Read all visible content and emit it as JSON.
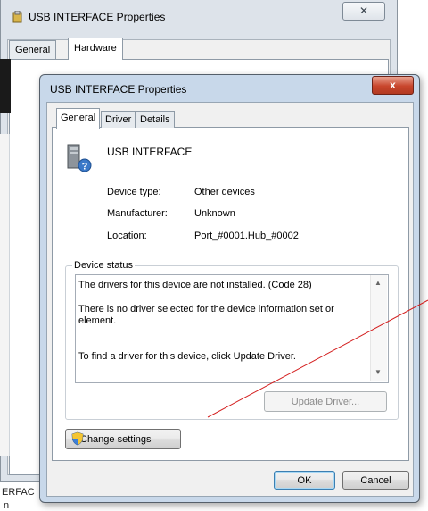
{
  "background_window": {
    "title": "USB INTERFACE Properties",
    "close_glyph": "✕",
    "tabs": [
      "General",
      "Hardware"
    ],
    "active_tab": "Hardware",
    "partial_text_1": "ERFAC",
    "partial_text_2": "n"
  },
  "dialog": {
    "title": "USB INTERFACE Properties",
    "close_glyph": "x",
    "tabs": [
      "General",
      "Driver",
      "Details"
    ],
    "active_tab": "General",
    "device_name": "USB INTERFACE",
    "properties": [
      {
        "label": "Device type:",
        "value": "Other devices"
      },
      {
        "label": "Manufacturer:",
        "value": "Unknown"
      },
      {
        "label": "Location:",
        "value": "Port_#0001.Hub_#0002"
      }
    ],
    "device_status": {
      "legend": "Device status",
      "lines": [
        "The drivers for this device are not installed. (Code 28)",
        "There is no driver selected for the device information set or element.",
        "To find a driver for this device, click Update Driver."
      ]
    },
    "buttons": {
      "update_driver": "Update Driver...",
      "change_settings": "Change settings",
      "ok": "OK",
      "cancel": "Cancel"
    }
  },
  "icons": {
    "app_icon": "device-properties-icon",
    "device_icon": "unknown-device-icon",
    "shield_icon": "uac-shield-icon"
  },
  "colors": {
    "annotation_line": "#d42020",
    "close_button": "#c8452c"
  }
}
